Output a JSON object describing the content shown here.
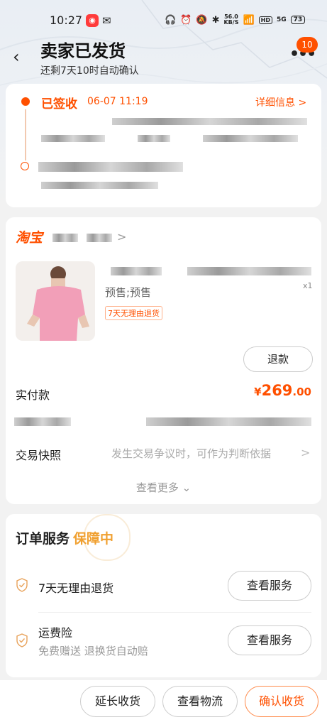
{
  "status_bar": {
    "time": "10:27",
    "net_speed": "56.0",
    "net_unit": "KB/S",
    "hd": "HD",
    "signal": "5G",
    "battery": "73"
  },
  "header": {
    "title": "卖家已发货",
    "subtitle": "还剩7天10时自动确认",
    "more_badge": "10"
  },
  "logistics": {
    "status": "已签收",
    "date": "06-07 11:19",
    "detail_link": "详细信息 >"
  },
  "order": {
    "shop_name": "淘宝",
    "product_option": "预售;预售",
    "policy_tag": "7天无理由退货",
    "quantity": "x1",
    "refund_label": "退款",
    "paid_label": "实付款",
    "paid_currency": "¥",
    "paid_integer": "269",
    "paid_decimal": ".00",
    "snapshot_label": "交易快照",
    "snapshot_desc": "发生交易争议时，可作为判断依据",
    "see_more": "查看更多"
  },
  "service": {
    "title": "订单服务",
    "title_highlight": "保障中",
    "items": [
      {
        "label": "7天无理由退货",
        "button": "查看服务"
      },
      {
        "label": "运费险",
        "sub": "免费赠送   退换货自动赔",
        "button": "查看服务"
      }
    ]
  },
  "bottom_bar": {
    "extend": "延长收货",
    "logistics": "查看物流",
    "confirm": "确认收货"
  },
  "colors": {
    "accent": "#ff5000",
    "gold": "#f0a030"
  }
}
